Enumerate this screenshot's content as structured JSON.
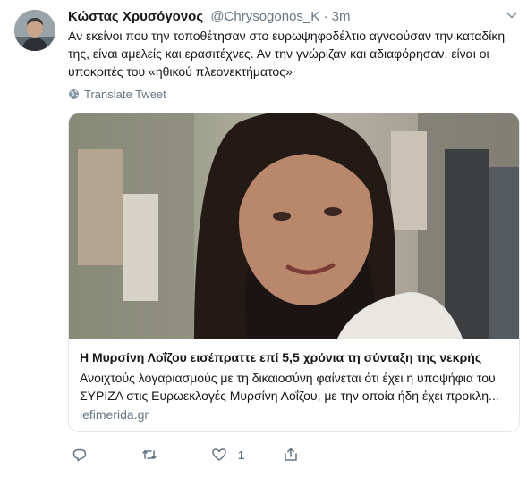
{
  "tweet": {
    "author_name": "Κώστας Χρυσόγονος",
    "handle": "@Chrysogonos_K",
    "separator": "·",
    "time": "3m",
    "text_lines": [
      "Αν εκείνοι που την τοποθέτησαν στο ευρωψηφοδέλτιο αγνοούσαν την καταδίκη",
      "της, είναι αμελείς και ερασιτέχνες. Αν την γνώριζαν και αδιαφόρησαν, είναι οι",
      "υποκριτές του «ηθικού πλεονεκτήματος»"
    ],
    "translate_label": "Translate Tweet"
  },
  "card": {
    "title": "Η Μυρσίνη Λοΐζου εισέπραττε επί 5,5 χρόνια τη σύνταξη της νεκρής",
    "description_lines": [
      "Ανοιχτούς λογαριασμούς με τη δικαιοσύνη φαίνεται ότι έχει η υποψήφια του",
      "ΣΥΡΙΖΑ στις Ευρωεκλογές Μυρσίνη Λοΐζου, με την οποία ήδη έχει προκλη..."
    ],
    "domain": "iefimerida.gr"
  },
  "actions": {
    "reply_count": "",
    "retweet_count": "",
    "like_count": "1",
    "share_count": ""
  },
  "icons": [
    "avatar",
    "chevron-down-icon",
    "globe-icon",
    "reply-icon",
    "retweet-icon",
    "heart-icon",
    "share-icon"
  ],
  "colors": {
    "text": "#14171a",
    "secondary": "#657786",
    "border": "#e1e8ed"
  }
}
